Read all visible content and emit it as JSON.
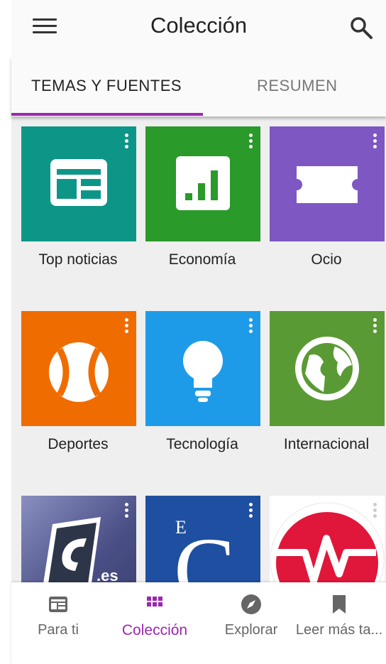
{
  "header": {
    "title": "Colección"
  },
  "tabs": [
    {
      "label": "TEMAS Y FUENTES"
    },
    {
      "label": "RESUMEN"
    }
  ],
  "tiles": [
    {
      "label": "Top noticias",
      "color": "#0d9688",
      "icon": "newspaper-icon"
    },
    {
      "label": "Economía",
      "color": "#2a9a2a",
      "icon": "chart-icon"
    },
    {
      "label": "Ocio",
      "color": "#7e57c2",
      "icon": "ticket-icon"
    },
    {
      "label": "Deportes",
      "color": "#ef6c00",
      "icon": "ball-icon"
    },
    {
      "label": "Tecnología",
      "color": "#1e9be8",
      "icon": "lightbulb-icon"
    },
    {
      "label": "Internacional",
      "color": "#5a9a34",
      "icon": "globe-icon"
    },
    {
      "label": ".es",
      "color": "#4a4f86",
      "icon": "source-logo-icon"
    },
    {
      "label": "E",
      "color": "#1f4fa0",
      "icon": "source-logo-icon"
    },
    {
      "label": "",
      "color": "#ffffff",
      "icon": "heartbeat-logo-icon"
    }
  ],
  "bottom_nav": [
    {
      "label": "Para ti",
      "icon": "newspaper-icon"
    },
    {
      "label": "Colección",
      "icon": "grid-icon"
    },
    {
      "label": "Explorar",
      "icon": "compass-icon"
    },
    {
      "label": "Leer más ta...",
      "icon": "bookmark-icon"
    }
  ],
  "colors": {
    "accent": "#9c27b0"
  }
}
